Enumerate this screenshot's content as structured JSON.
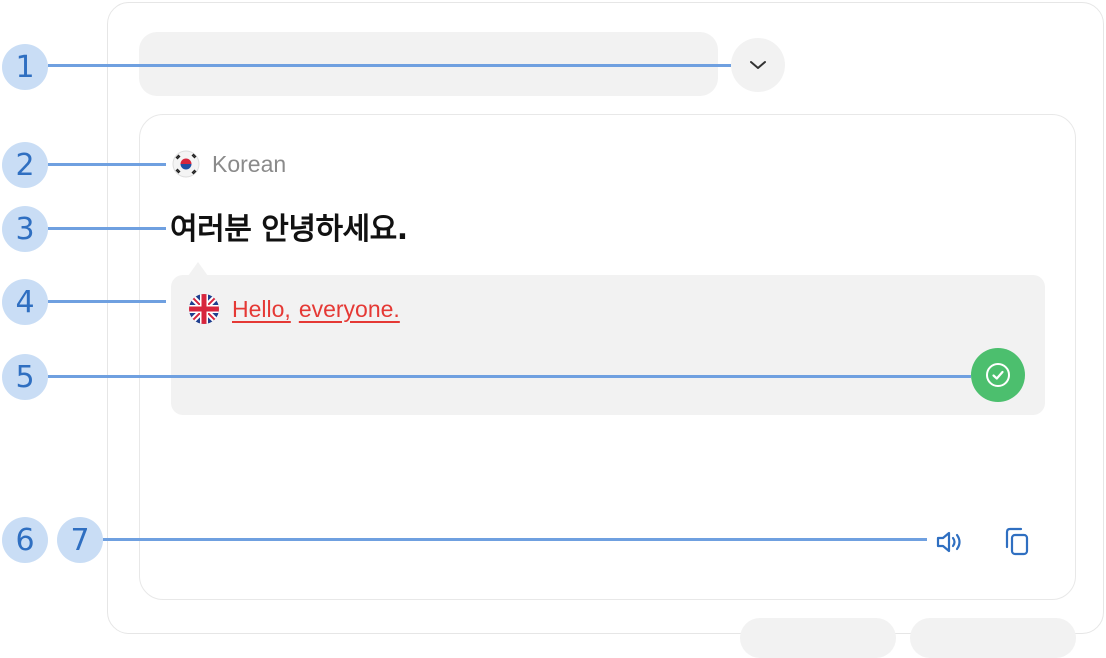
{
  "source": {
    "language": "Korean",
    "text": "여러분 안녕하세요."
  },
  "translation": {
    "words": [
      "Hello,",
      "everyone."
    ]
  },
  "icons": {
    "chevron": "chevron-down-icon",
    "source_flag": "south-korea-flag-icon",
    "target_flag": "uk-flag-icon",
    "check": "check-circle-icon",
    "speaker": "speaker-icon",
    "copy": "copy-icon"
  },
  "colors": {
    "accent_blue": "#2f6fc1",
    "success_green": "#4cbf6e",
    "error_red": "#e53935",
    "panel_gray": "#f2f2f2"
  },
  "callouts": [
    "1",
    "2",
    "3",
    "4",
    "5",
    "6",
    "7"
  ]
}
